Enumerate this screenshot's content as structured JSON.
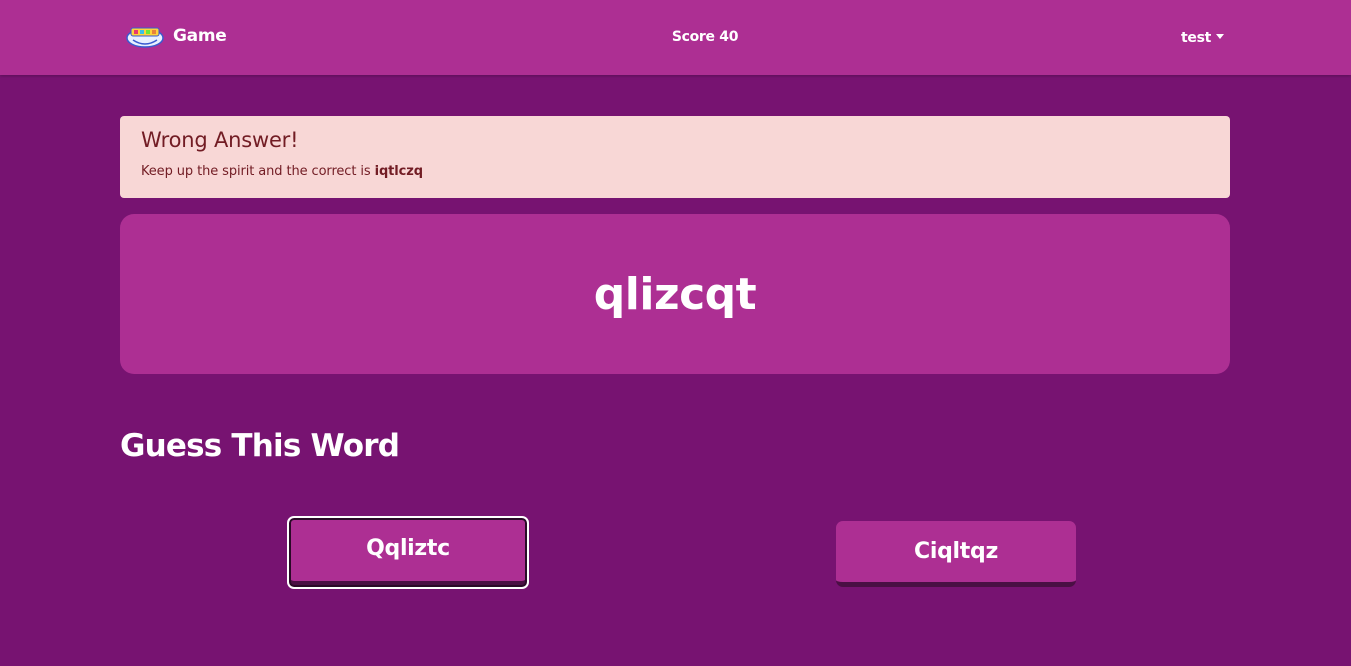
{
  "navbar": {
    "brand": "Game",
    "logo_icon": "game-logo-icon",
    "score": "Score 40",
    "user": "test",
    "user_caret_icon": "caret-down-icon"
  },
  "alert": {
    "title": "Wrong Answer!",
    "message_prefix": "Keep up the spirit and the correct is ",
    "correct_word": "iqtlczq"
  },
  "word_card": {
    "word": "qlizcqt"
  },
  "section": {
    "title": "Guess This Word"
  },
  "choices": [
    {
      "label": "Qqliztc"
    },
    {
      "label": "Ciqltqz"
    }
  ],
  "colors": {
    "background": "#771371",
    "accent": "#ad2f93",
    "alert_bg": "#f8d7d6",
    "alert_text": "#721c24"
  }
}
